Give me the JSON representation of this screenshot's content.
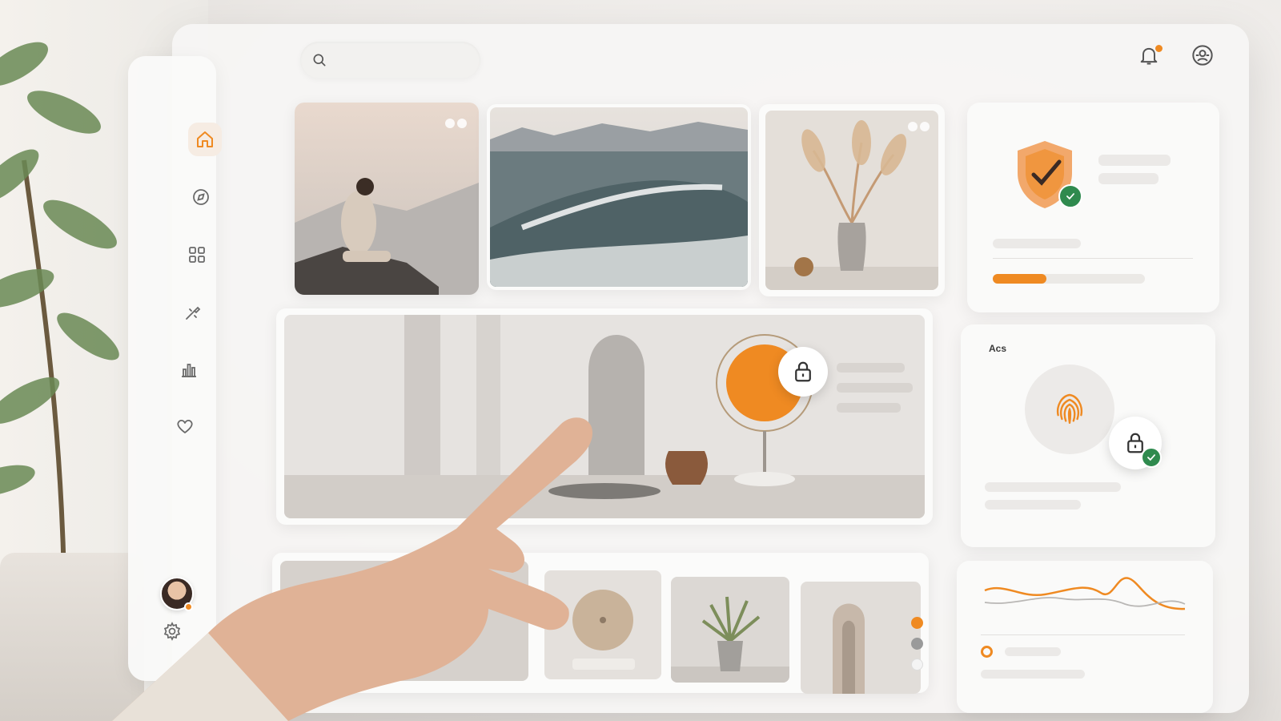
{
  "search": {
    "placeholder": "",
    "value": ""
  },
  "sidebar": {
    "items": [
      {
        "icon": "home-icon",
        "active": true
      },
      {
        "icon": "compass-icon",
        "active": false
      },
      {
        "icon": "grid-icon",
        "active": false
      },
      {
        "icon": "tools-icon",
        "active": false
      },
      {
        "icon": "bar-chart-icon",
        "active": false
      },
      {
        "icon": "heart-icon",
        "active": false
      }
    ],
    "footer": [
      {
        "icon": "avatar"
      },
      {
        "icon": "gear-icon"
      }
    ]
  },
  "header": {
    "icons": [
      "bell-icon",
      "profile-icon"
    ]
  },
  "gallery": {
    "top_row": [
      "woman-on-cliff-photo",
      "ocean-wave-photo",
      "pampas-vase-photo"
    ],
    "featured": "arch-interior-photo",
    "bottom_row": [
      "arch-room-photo",
      "stone-disc-photo",
      "potted-palm-photo",
      "arch-hallway-photo"
    ]
  },
  "widgets": {
    "security": {
      "icon": "shield-check-icon",
      "progress": 0.35
    },
    "biometric": {
      "label": "Aᴄs",
      "icon": "fingerprint-icon",
      "lock": "lock-icon"
    },
    "activity": {
      "icon": "line-chart"
    }
  },
  "colors": {
    "accent": "#ef8a22",
    "success": "#2f8a4e",
    "panel": "#f6f5f4"
  }
}
